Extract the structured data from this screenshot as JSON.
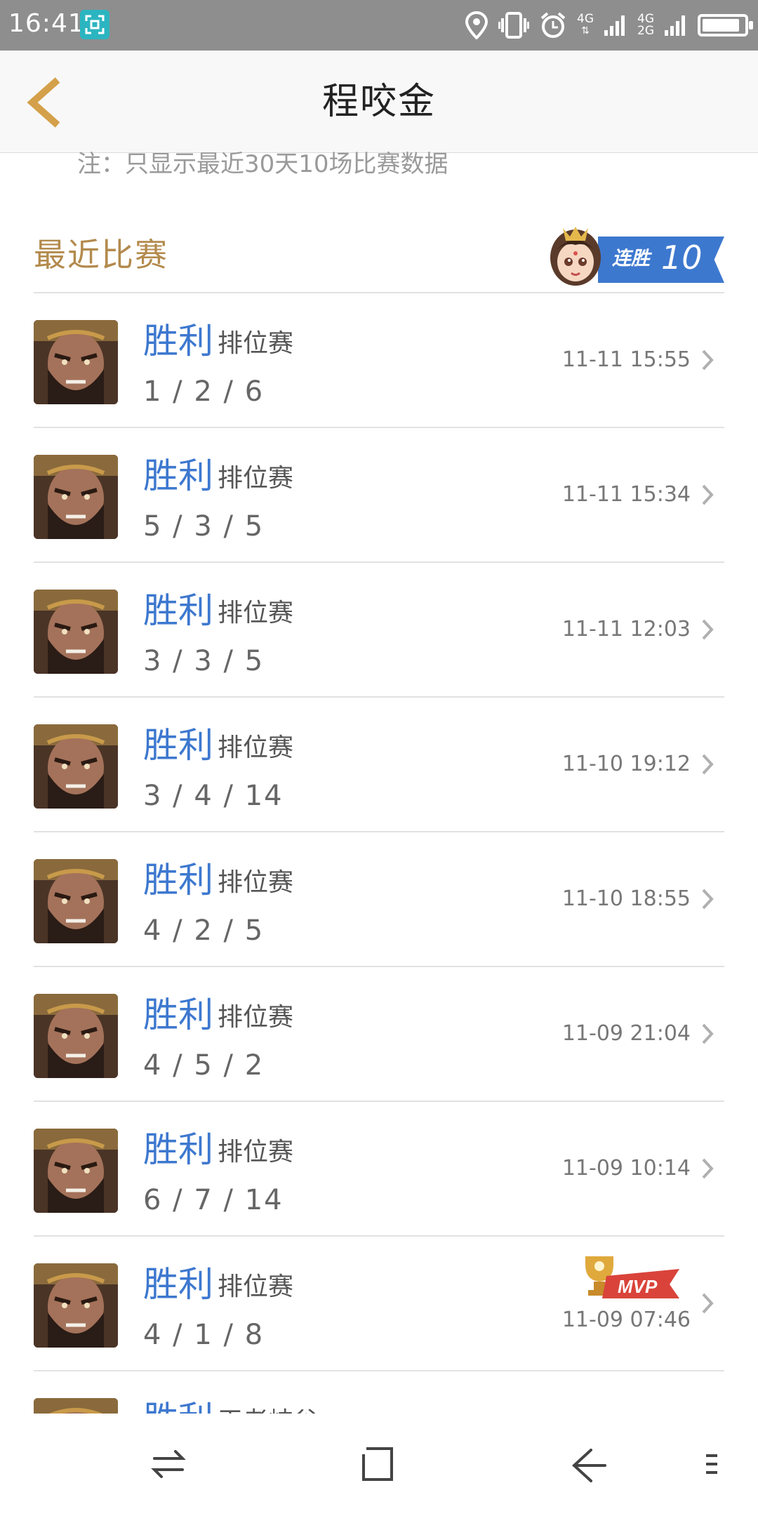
{
  "status_bar": {
    "time": "16:41",
    "network_top": "4G",
    "network_top2": "4G",
    "network_bottom2": "2G",
    "battery_level": 0.9
  },
  "header": {
    "title": "程咬金"
  },
  "note": "注：只显示最近30天10场比赛数据",
  "section": {
    "title": "最近比赛",
    "streak_label": "连胜",
    "streak_count": "10"
  },
  "matches": [
    {
      "result": "胜利",
      "mode": "排位赛",
      "kda": "1 / 2 / 6",
      "time": "11-11 15:55",
      "mvp": false
    },
    {
      "result": "胜利",
      "mode": "排位赛",
      "kda": "5 / 3 / 5",
      "time": "11-11 15:34",
      "mvp": false
    },
    {
      "result": "胜利",
      "mode": "排位赛",
      "kda": "3 / 3 / 5",
      "time": "11-11 12:03",
      "mvp": false
    },
    {
      "result": "胜利",
      "mode": "排位赛",
      "kda": "3 / 4 / 14",
      "time": "11-10 19:12",
      "mvp": false
    },
    {
      "result": "胜利",
      "mode": "排位赛",
      "kda": "4 / 2 / 5",
      "time": "11-10 18:55",
      "mvp": false
    },
    {
      "result": "胜利",
      "mode": "排位赛",
      "kda": "4 / 5 / 2",
      "time": "11-09 21:04",
      "mvp": false
    },
    {
      "result": "胜利",
      "mode": "排位赛",
      "kda": "6 / 7 / 14",
      "time": "11-09 10:14",
      "mvp": false
    },
    {
      "result": "胜利",
      "mode": "排位赛",
      "kda": "4 / 1 / 8",
      "time": "11-09 07:46",
      "mvp": true,
      "mvp_label": "MVP"
    },
    {
      "result": "胜利",
      "mode": "王者峡谷",
      "kda": "",
      "time": "",
      "mvp": false
    }
  ],
  "colors": {
    "accent_gold": "#b38a4d",
    "win_blue": "#3d78cf",
    "status_bar": "#8e8e8e"
  },
  "icons": {
    "back": "chevron-left-icon",
    "row_arrow": "chevron-right-icon",
    "nav": [
      "switch-arrows-icon",
      "home-square-icon",
      "back-arrow-icon",
      "menu-icon"
    ]
  }
}
